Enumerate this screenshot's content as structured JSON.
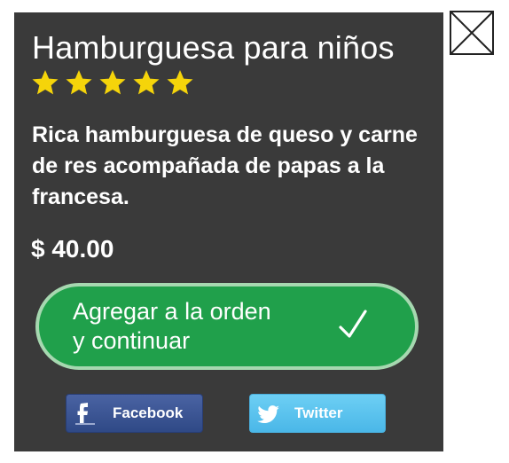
{
  "product": {
    "title": "Hamburguesa para niños",
    "rating": 5,
    "rating_max": 5,
    "description": "Rica hamburguesa de queso y carne de res acompañada de papas a la francesa.",
    "price": "$ 40.00"
  },
  "actions": {
    "add_label_line1": "Agregar a la orden",
    "add_label_line2": "y continuar",
    "facebook_label": "Facebook",
    "twitter_label": "Twitter"
  },
  "icons": {
    "star": "star-icon",
    "check": "checkmark-icon",
    "facebook": "facebook-icon",
    "twitter": "twitter-bird-icon",
    "close": "close-icon"
  },
  "colors": {
    "card_background": "#3a3a3a",
    "star": "#f5d40a",
    "add_button": "#20a04b",
    "add_button_border": "#a6d8b0",
    "facebook": "#3b5998",
    "twitter": "#55c3f0"
  }
}
